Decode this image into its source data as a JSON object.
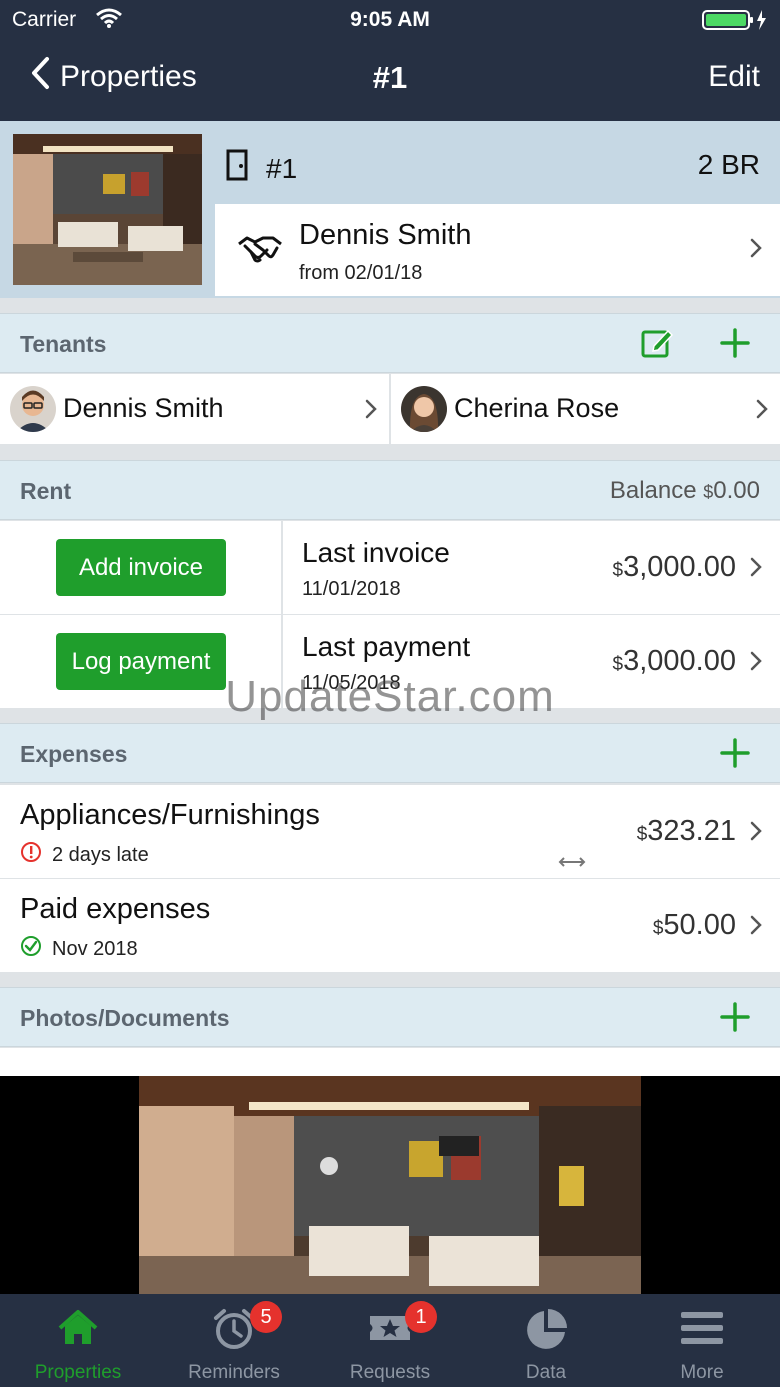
{
  "status_bar": {
    "carrier": "Carrier",
    "time": "9:05 AM"
  },
  "nav": {
    "back_label": "Properties",
    "title": "#1",
    "edit_label": "Edit"
  },
  "property": {
    "unit": "#1",
    "bedrooms": "2 BR",
    "lease_tenant": "Dennis Smith",
    "lease_from": "from 02/01/18"
  },
  "tenants": {
    "header": "Tenants",
    "items": [
      {
        "name": "Dennis Smith"
      },
      {
        "name": "Cherina Rose"
      }
    ]
  },
  "rent": {
    "header": "Rent",
    "balance_label": "Balance",
    "balance_currency": "$",
    "balance_value": "0.00",
    "add_invoice_label": "Add invoice",
    "log_payment_label": "Log payment",
    "last_invoice": {
      "label": "Last invoice",
      "date": "11/01/2018",
      "currency": "$",
      "amount": "3,000.00"
    },
    "last_payment": {
      "label": "Last payment",
      "date": "11/05/2018",
      "currency": "$",
      "amount": "3,000.00"
    }
  },
  "expenses": {
    "header": "Expenses",
    "items": [
      {
        "label": "Appliances/Furnishings",
        "sub": "2 days late",
        "currency": "$",
        "amount": "323.21",
        "status": "late"
      },
      {
        "label": "Paid expenses",
        "sub": "Nov 2018",
        "currency": "$",
        "amount": "50.00",
        "status": "paid"
      }
    ]
  },
  "photos": {
    "header": "Photos/Documents"
  },
  "watermark": "UpdateStar.com",
  "tabs": [
    {
      "label": "Properties",
      "active": true
    },
    {
      "label": "Reminders",
      "badge": "5"
    },
    {
      "label": "Requests",
      "badge": "1"
    },
    {
      "label": "Data"
    },
    {
      "label": "More"
    }
  ],
  "colors": {
    "nav_bg": "#263043",
    "accent_green": "#1f9e2c",
    "section_bg": "#ddebf2",
    "badge_red": "#e5322d"
  }
}
